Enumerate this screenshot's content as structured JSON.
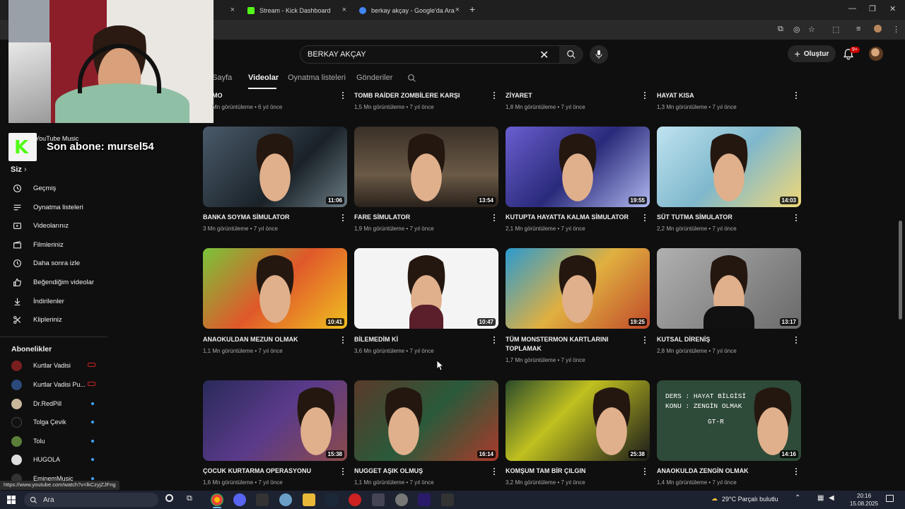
{
  "browser": {
    "tabs": [
      {
        "label": "",
        "favicon_color": "#ff0000"
      },
      {
        "label": "Stream - Kick Dashboard",
        "favicon_color": "#53fc18"
      },
      {
        "label": "berkay akçay - Google'da Ara",
        "favicon_color": "#4285f4"
      }
    ]
  },
  "header": {
    "search_value": "BERKAY AKÇAY",
    "create_label": "Oluştur",
    "notification_badge": "9+"
  },
  "channel_tabs": [
    {
      "label": "a Sayfa"
    },
    {
      "label": "Videolar"
    },
    {
      "label": "Oynatma listeleri"
    },
    {
      "label": "Gönderiler"
    }
  ],
  "overlay": {
    "kick_letter": "K",
    "last_subscriber": "Son abone: mursel54"
  },
  "sidebar": {
    "partial_item": "YouTube Music",
    "you_heading": "Siz",
    "you_items": [
      {
        "label": "Geçmiş",
        "icon": "history-icon"
      },
      {
        "label": "Oynatma listeleri",
        "icon": "playlists-icon"
      },
      {
        "label": "Videolarınız",
        "icon": "your-videos-icon"
      },
      {
        "label": "Filmleriniz",
        "icon": "movies-icon"
      },
      {
        "label": "Daha sonra izle",
        "icon": "watch-later-icon"
      },
      {
        "label": "Beğendiğim videolar",
        "icon": "like-icon"
      },
      {
        "label": "İndirilenler",
        "icon": "download-icon"
      },
      {
        "label": "Klipleriniz",
        "icon": "clips-icon"
      }
    ],
    "subscriptions_heading": "Abonelikler",
    "subscriptions": [
      {
        "label": "Kurtlar Vadisi",
        "indicator": "live",
        "color": "#7a1f1f"
      },
      {
        "label": "Kurtlar Vadisi Pu...",
        "indicator": "live",
        "color": "#2b4a7a"
      },
      {
        "label": "Dr.RedPill",
        "indicator": "dot",
        "color": "#c9b79c"
      },
      {
        "label": "Tolga Çevik",
        "indicator": "dot",
        "color": "#111111"
      },
      {
        "label": "Tolu",
        "indicator": "dot",
        "color": "#5b7f3a"
      },
      {
        "label": "HUGOLA",
        "indicator": "dot",
        "color": "#dddddd"
      },
      {
        "label": "EminemMusic",
        "indicator": "dot",
        "color": "#333333"
      }
    ]
  },
  "videos": [
    {
      "title": "MO",
      "meta": "Mn görüntüleme • 6 yıl önce",
      "duration": ""
    },
    {
      "title": "TOMB RAİDER ZOMBİLERE KARŞI",
      "meta": "1,5 Mn görüntüleme • 7 yıl önce",
      "duration": ""
    },
    {
      "title": "ZİYARET",
      "meta": "1,8 Mn görüntüleme • 7 yıl önce",
      "duration": ""
    },
    {
      "title": "HAYAT KISA",
      "meta": "1,3 Mn görüntüleme • 7 yıl önce",
      "duration": ""
    },
    {
      "title": "BANKA SOYMA SİMULATOR",
      "meta": "3 Mn görüntüleme • 7 yıl önce",
      "duration": "11:06",
      "bg": "#2a3440"
    },
    {
      "title": "FARE SİMULATOR",
      "meta": "1,9 Mn görüntüleme • 7 yıl önce",
      "duration": "13:54",
      "bg": "#5a4a3a"
    },
    {
      "title": "KUTUPTA HAYATTA KALMA SİMULATOR",
      "meta": "2,1 Mn görüntüleme • 7 yıl önce",
      "duration": "19:55",
      "bg": "#4a3f9a"
    },
    {
      "title": "SÜT TUTMA SİMULATOR",
      "meta": "2,2 Mn görüntüleme • 7 yıl önce",
      "duration": "14:03",
      "bg": "#8fc3d8"
    },
    {
      "title": "ANAOKULDAN MEZUN OLMAK",
      "meta": "1,1 Mn görüntüleme • 7 yıl önce",
      "duration": "10:41",
      "bg": "#c8541e"
    },
    {
      "title": "BİLEMEDİM Kİ",
      "meta": "3,6 Mn görüntüleme • 7 yıl önce",
      "duration": "10:47",
      "bg": "#f2f2f2"
    },
    {
      "title": "TÜM MONSTERMON KARTLARINI TOPLAMAK",
      "meta": "1,7 Mn görüntüleme • 7 yıl önce",
      "duration": "19:25",
      "bg": "#2f86b8"
    },
    {
      "title": "KUTSAL DİRENİŞ",
      "meta": "2,8 Mn görüntüleme • 7 yıl önce",
      "duration": "13:17",
      "bg": "#9c9c9c"
    },
    {
      "title": "ÇOCUK KURTARMA OPERASYONU",
      "meta": "1,6 Mn görüntüleme • 7 yıl önce",
      "duration": "15:38",
      "bg": "#3a3a7a"
    },
    {
      "title": "NUGGET AŞIK OLMUŞ",
      "meta": "1,1 Mn görüntüleme • 7 yıl önce",
      "duration": "16:14",
      "bg": "#7a3a2a"
    },
    {
      "title": "KOMŞUM TAM BİR ÇILGIN",
      "meta": "3,2 Mn görüntüleme • 7 yıl önce",
      "duration": "25:38",
      "bg": "#1f3a2a"
    },
    {
      "title": "ANAOKULDA ZENGİN OLMAK",
      "meta": "1,4 Mn görüntüleme • 7 yıl önce",
      "duration": "14:16",
      "bg": "#2d4a3a"
    }
  ],
  "thumb_text": {
    "board_line1": "DERS : HAYAT BİLGİSİ",
    "board_line2": "KONU : ZENGİN OLMAK",
    "board_car": "GT-R"
  },
  "status_url": "https://www.youtube.com/watch?v=lkCzyjZJFng",
  "taskbar": {
    "search_label": "Ara",
    "weather": "29°C  Parçalı bulutlu",
    "time": "20:16",
    "date": "15.08.2025"
  }
}
